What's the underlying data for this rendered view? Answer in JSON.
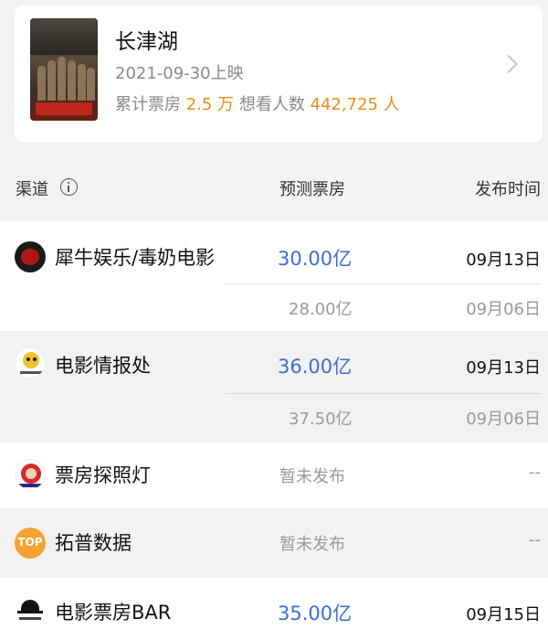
{
  "movie": {
    "title": "长津湖",
    "release": "2021-09-30上映",
    "box_label": "累计票房",
    "box_value": "2.5 万",
    "want_label": "想看人数",
    "want_value": "442,725 人",
    "accent_color": "#f08c18"
  },
  "table_header": {
    "channel": "渠道",
    "forecast": "预测票房",
    "time": "发布时间"
  },
  "channels": [
    {
      "name": "犀牛娱乐/毒奶电影",
      "icon": "xiniu-logo-icon",
      "entries": [
        {
          "forecast": "30.00亿",
          "date": "09月13日"
        },
        {
          "forecast": "28.00亿",
          "date": "09月06日"
        }
      ]
    },
    {
      "name": "电影情报处",
      "icon": "qingbaochu-logo-icon",
      "entries": [
        {
          "forecast": "36.00亿",
          "date": "09月13日"
        },
        {
          "forecast": "37.50亿",
          "date": "09月06日"
        }
      ]
    },
    {
      "name": "票房探照灯",
      "icon": "tanzhaodeng-logo-icon",
      "entries": [
        {
          "forecast": "暂未发布",
          "date": "--"
        }
      ]
    },
    {
      "name": "拓普数据",
      "icon": "top-logo-icon",
      "logo_text": "TOP",
      "entries": [
        {
          "forecast": "暂未发布",
          "date": "--"
        }
      ]
    },
    {
      "name": "电影票房BAR",
      "icon": "bar-logo-icon",
      "entries": [
        {
          "forecast": "35.00亿",
          "date": "09月15日"
        }
      ]
    }
  ],
  "colors": {
    "forecast_blue": "#3a6fd0",
    "muted_gray": "#999999",
    "page_bg": "#f2f2f2"
  }
}
